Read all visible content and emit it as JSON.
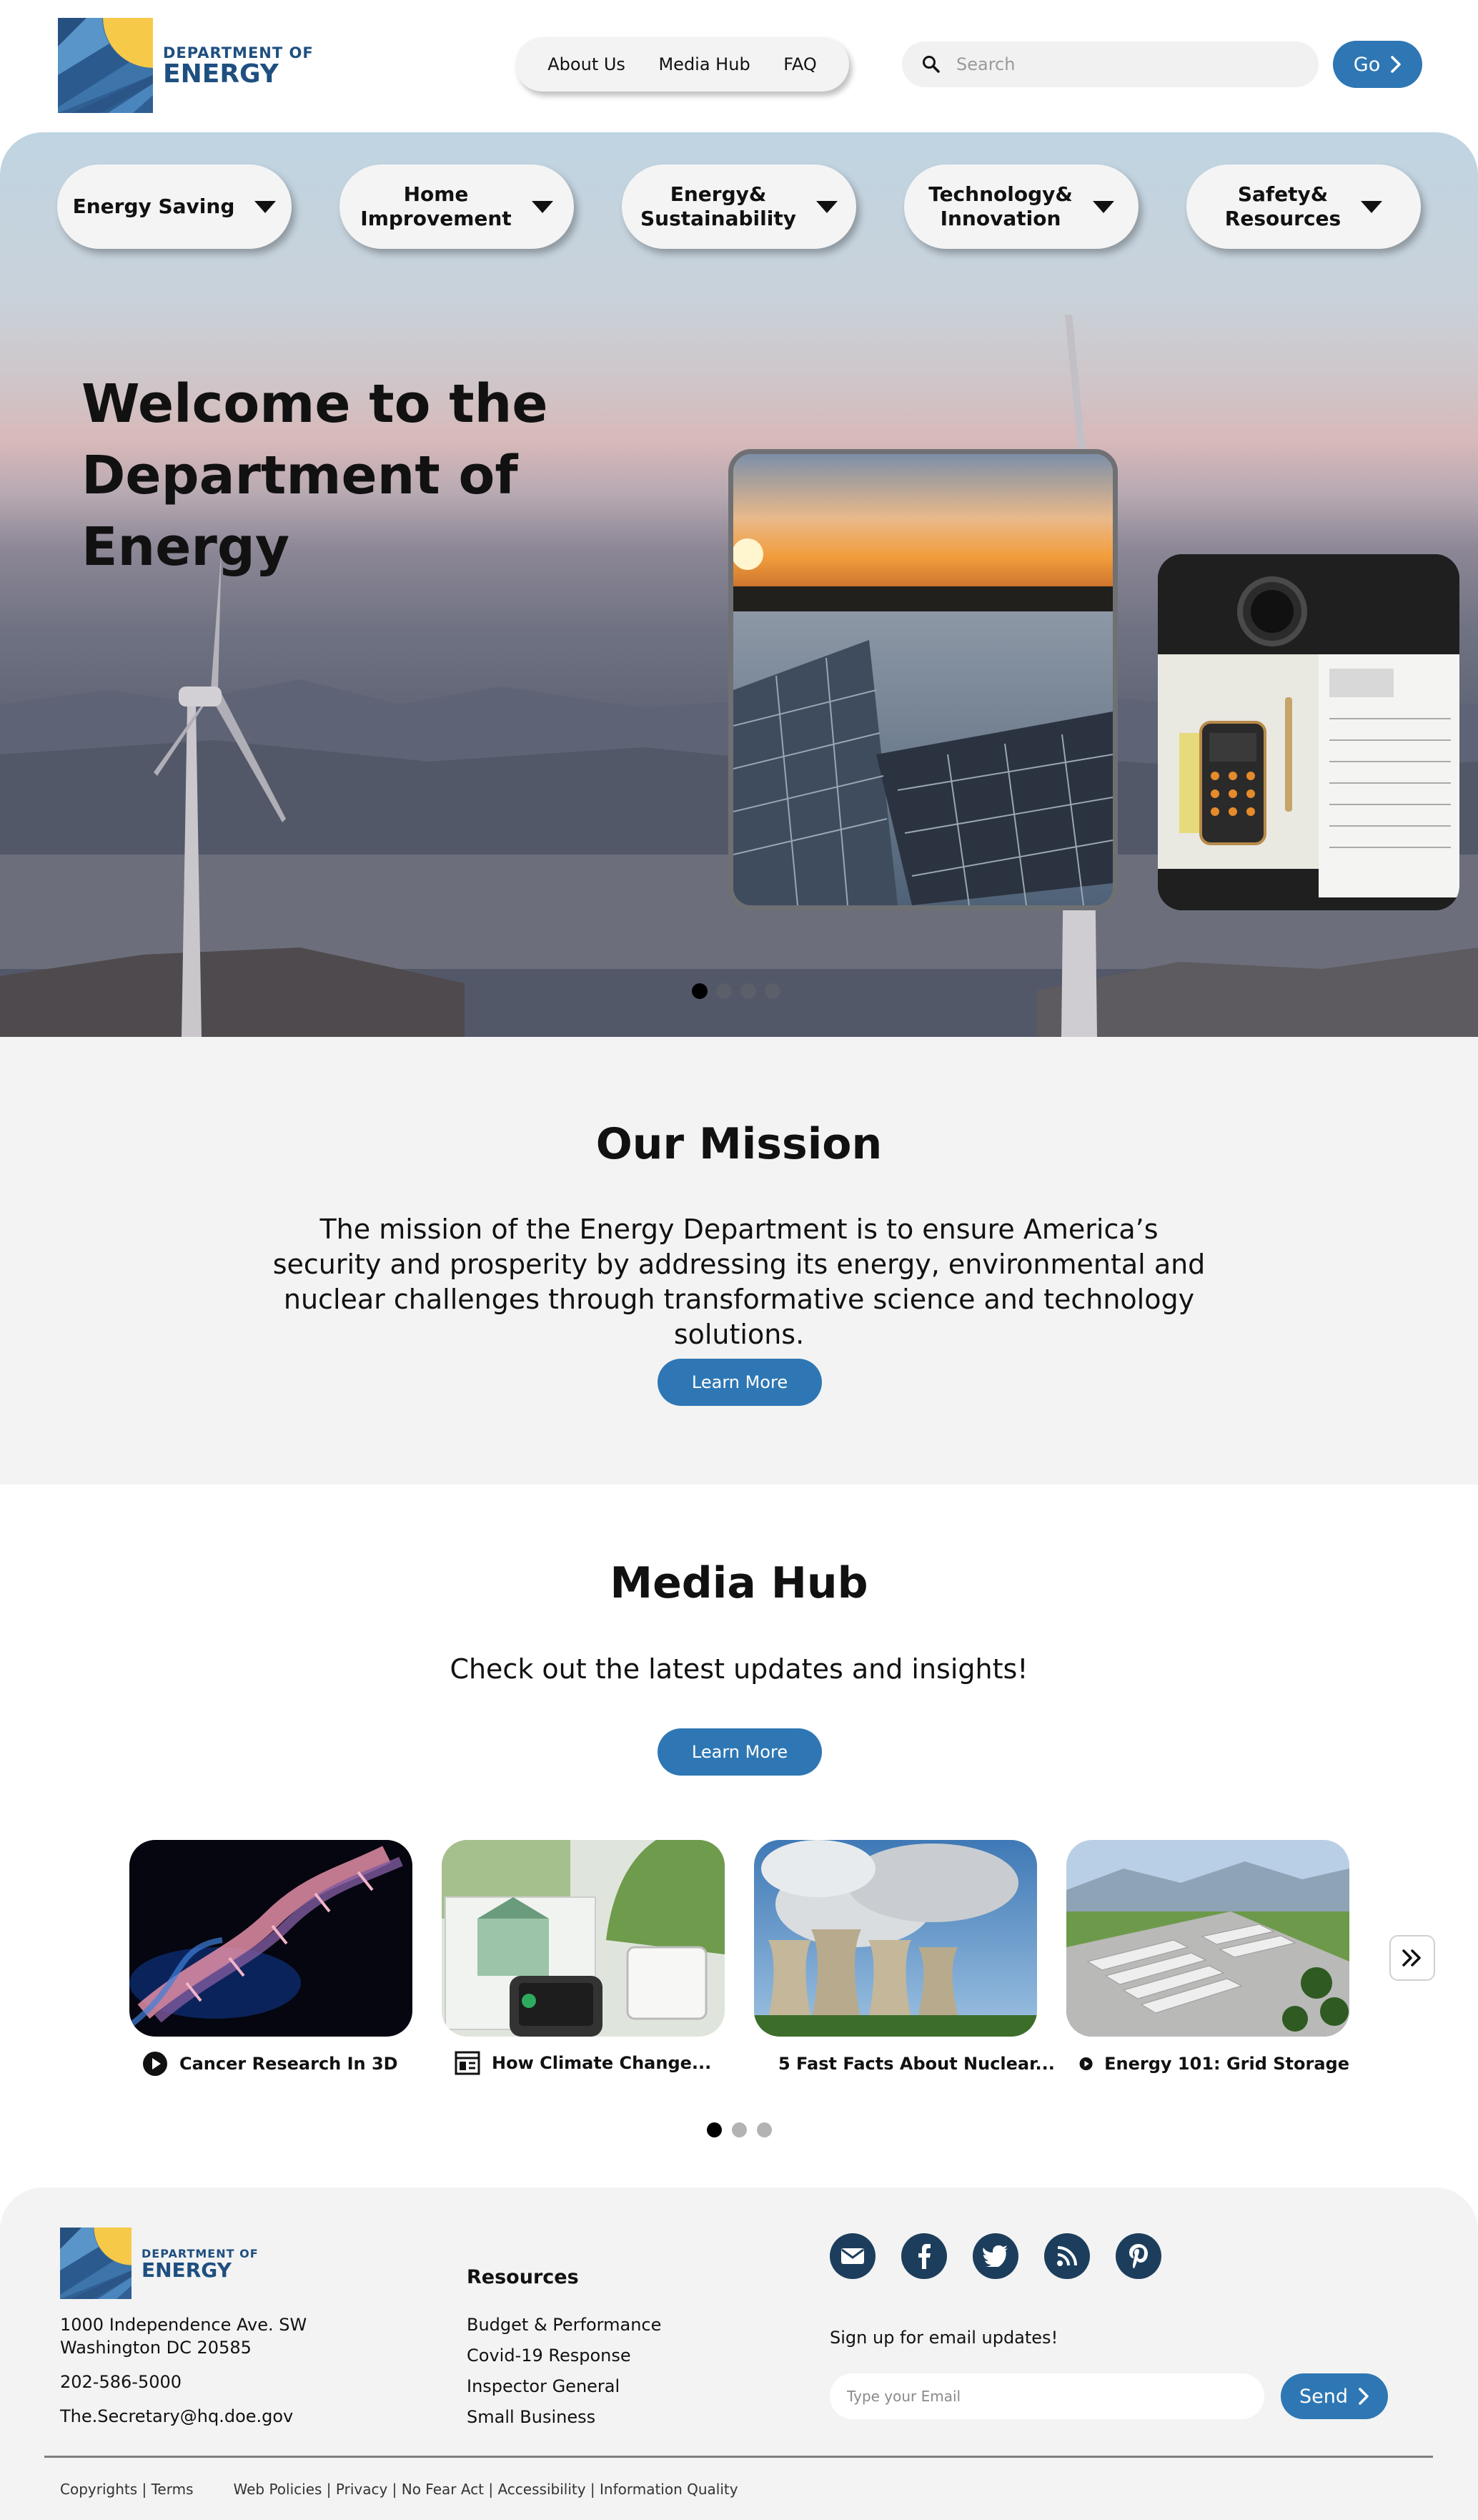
{
  "brand": {
    "line1": "DEPARTMENT OF",
    "line2": "ENERGY",
    "colors": {
      "navy": "#1f4f80",
      "blue": "#2e77b4",
      "sun": "#f7c948",
      "social": "#1c3e5c"
    }
  },
  "topnav": {
    "items": [
      "About Us",
      "Media Hub",
      "FAQ"
    ]
  },
  "search": {
    "placeholder": "Search",
    "icon": "search-icon",
    "go_label": "Go"
  },
  "categories": [
    {
      "label": "Energy Saving"
    },
    {
      "label": "Home\nImprovement"
    },
    {
      "label": "Energy&\nSustainability"
    },
    {
      "label": "Technology&\nInnovation"
    },
    {
      "label": "Safety&\nResources"
    }
  ],
  "hero": {
    "title": "Welcome to the Department of Energy",
    "slides_total": 4,
    "slide_active": 1
  },
  "mission": {
    "title": "Our Mission",
    "text": "The mission of the Energy Department is to ensure America’s security and prosperity by addressing its energy, environmental and nuclear challenges through transformative science and technology solutions.",
    "button": "Learn More"
  },
  "media": {
    "title": "Media Hub",
    "subtitle": "Check out the latest updates and insights!",
    "button": "Learn More",
    "cards": [
      {
        "caption": "Cancer Research In 3D",
        "icon": "play-icon"
      },
      {
        "caption": "How Climate Change...",
        "icon": "article-icon"
      },
      {
        "caption": "5 Fast Facts About Nuclear...",
        "icon": "document-icon"
      },
      {
        "caption": "Energy 101: Grid Storage",
        "icon": "play-icon"
      }
    ],
    "pages_total": 3,
    "page_active": 1
  },
  "footer": {
    "brand_line1": "DEPARTMENT OF",
    "brand_line2": "ENERGY",
    "address1": "1000 Independence Ave. SW",
    "address2": "Washington DC 20585",
    "phone": "202-586-5000",
    "email": "The.Secretary@hq.doe.gov",
    "resources_title": "Resources",
    "resources": [
      "Budget & Performance",
      "Covid-19 Response",
      "Inspector General",
      "Small Business"
    ],
    "socials": [
      "mail-icon",
      "facebook-icon",
      "twitter-icon",
      "rss-icon",
      "pinterest-icon"
    ],
    "signup_label": "Sign up for email updates!",
    "email_placeholder": "Type your Email",
    "send_label": "Send",
    "legal_left": "Copyrights | Terms",
    "legal_right": "Web Policies | Privacy | No Fear Act | Accessibility | Information Quality"
  }
}
